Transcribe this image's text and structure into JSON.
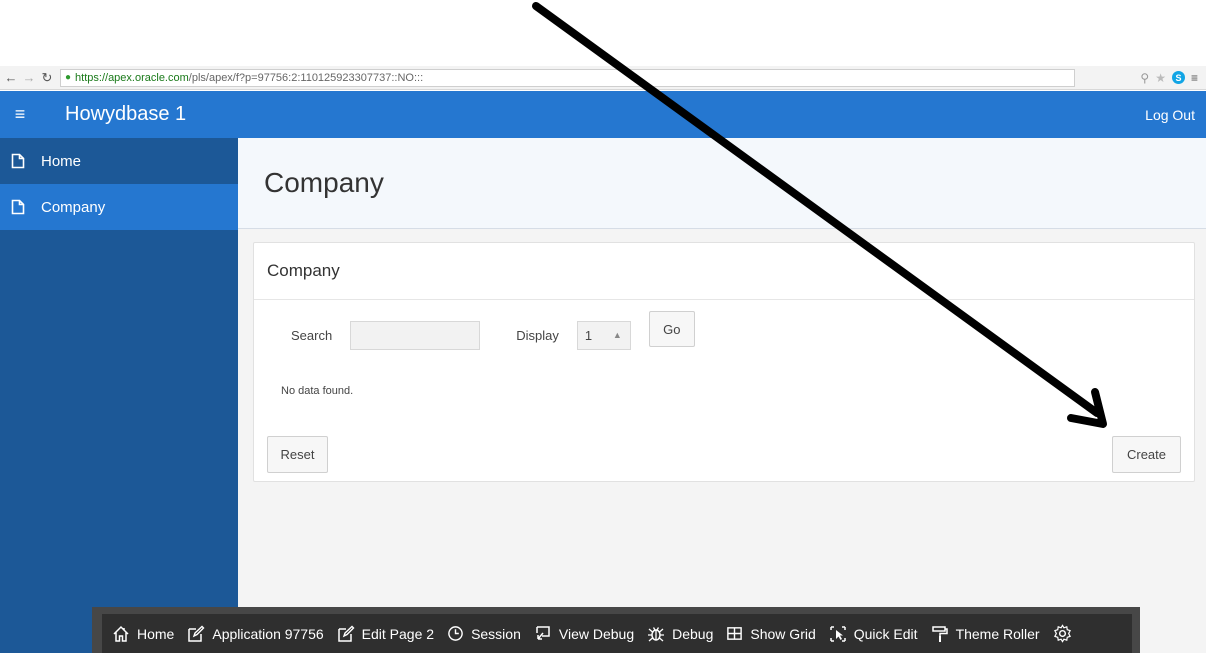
{
  "browser": {
    "url_secure": "https://apex.oracle.com",
    "url_rest": "/pls/apex/f?p=97756:2:110125923307737::NO:::"
  },
  "header": {
    "app_title": "Howydbase 1",
    "logout_label": "Log Out"
  },
  "sidebar": {
    "items": [
      {
        "label": "Home",
        "active": false
      },
      {
        "label": "Company",
        "active": true
      }
    ]
  },
  "page": {
    "title": "Company"
  },
  "region": {
    "title": "Company",
    "search_label": "Search",
    "search_value": "",
    "display_label": "Display",
    "display_value": "1",
    "go_label": "Go",
    "no_data": "No data found.",
    "reset_label": "Reset",
    "create_label": "Create"
  },
  "devbar": {
    "items": [
      {
        "label": "Home",
        "icon": "home-icon"
      },
      {
        "label": "Application 97756",
        "icon": "edit-icon"
      },
      {
        "label": "Edit Page 2",
        "icon": "edit-icon"
      },
      {
        "label": "Session",
        "icon": "clock-icon"
      },
      {
        "label": "View Debug",
        "icon": "view-debug-icon"
      },
      {
        "label": "Debug",
        "icon": "bug-icon"
      },
      {
        "label": "Show Grid",
        "icon": "grid-icon"
      },
      {
        "label": "Quick Edit",
        "icon": "quick-edit-icon"
      },
      {
        "label": "Theme Roller",
        "icon": "paint-roller-icon"
      },
      {
        "label": "",
        "icon": "gear-icon"
      }
    ]
  },
  "colors": {
    "header_blue": "#2577d0",
    "sidebar_blue": "#1c5897",
    "arrow": "#000000"
  }
}
